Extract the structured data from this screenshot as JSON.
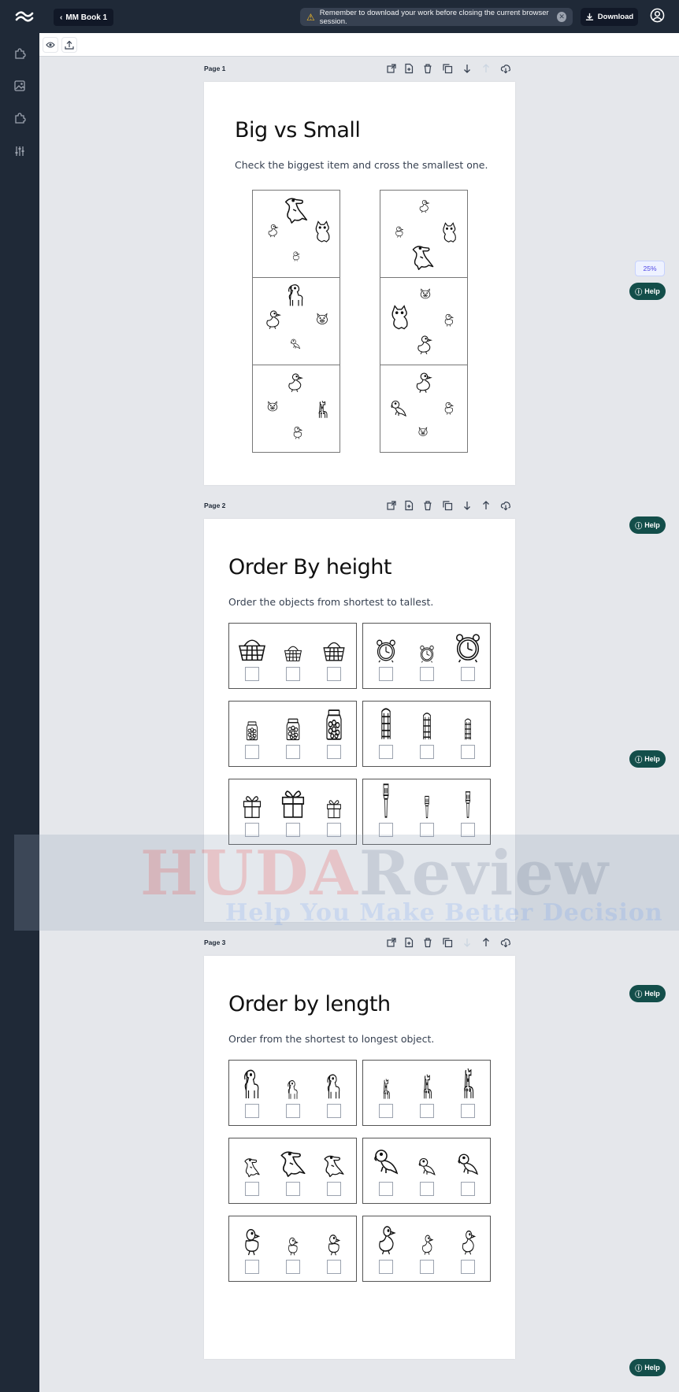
{
  "topbar": {
    "book_button_label": "MM Book 1",
    "notice_text": "Remember to download your work before closing the current browser session.",
    "download_label": "Download"
  },
  "zoom_level": "25%",
  "help_label": "Help",
  "watermark": {
    "part1": "HUDA",
    "part2": "Review",
    "tagline": "Help You Make Better Decision"
  },
  "pages": [
    {
      "label": "Page 1",
      "title": "Big vs Small",
      "subtitle": "Check the biggest item and cross the smallest one."
    },
    {
      "label": "Page 2",
      "title": "Order By height",
      "subtitle": "Order the objects from shortest to tallest."
    },
    {
      "label": "Page 3",
      "title": "Order by length",
      "subtitle": "Order from the shortest to longest object."
    }
  ],
  "icons": {
    "page_actions": [
      "external-edit-icon",
      "new-page-icon",
      "trash-icon",
      "duplicate-icon",
      "move-down-icon",
      "move-up-icon",
      "cloud-download-icon"
    ],
    "rail": [
      "puzzle-icon",
      "image-icon",
      "puzzle-icon",
      "sliders-icon"
    ]
  },
  "colors": {
    "dark": "#1f2937",
    "help": "#134e4a",
    "accent": "#4f46e5"
  }
}
